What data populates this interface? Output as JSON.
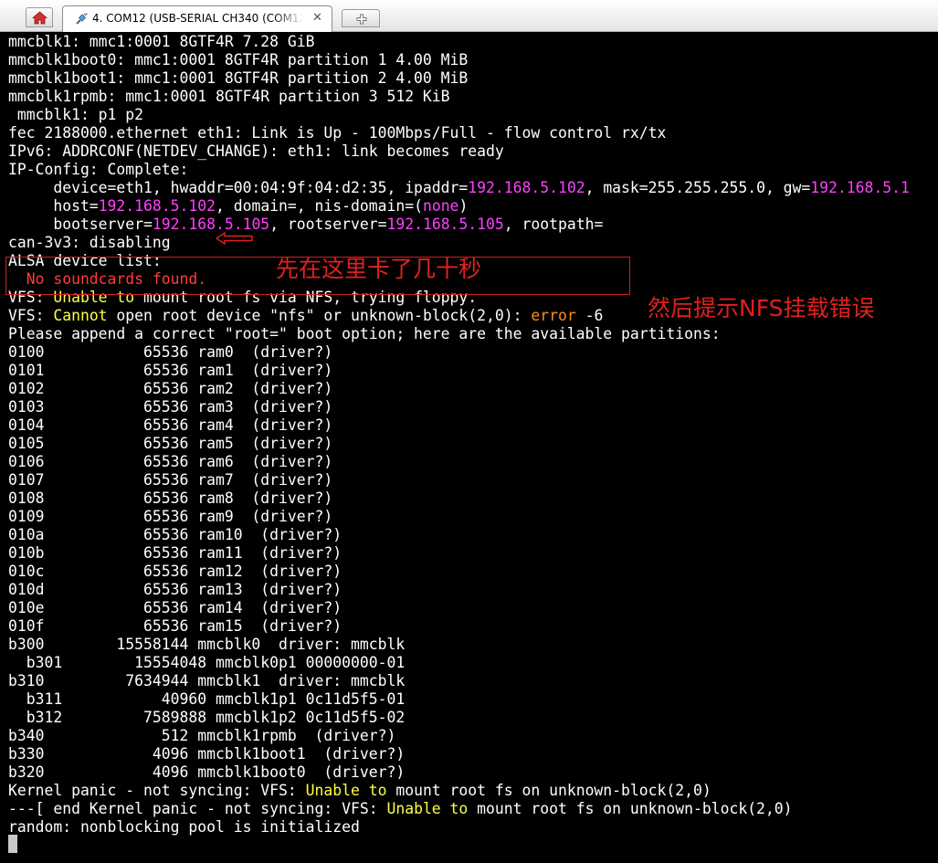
{
  "tab": {
    "title": "4. COM12  (USB-SERIAL CH340 (COM12))",
    "close_glyph": "✕",
    "icon": "plug-icon"
  },
  "icons": {
    "home": "home-icon",
    "new_tab": "new-tab-icon"
  },
  "colors": {
    "background": "#000000",
    "text": "#ffffff",
    "ip_highlight": "#ff40ff",
    "warning_highlight": "#ffff40",
    "error_text": "#ff3c3c",
    "error_code": "#ff8c19",
    "annotation": "#e02020"
  },
  "terminal": {
    "lines": [
      [
        {
          "t": "mmcblk1: mmc1:0001 8GTF4R 7.28 GiB"
        }
      ],
      [
        {
          "t": "mmcblk1boot0: mmc1:0001 8GTF4R partition 1 4.00 MiB"
        }
      ],
      [
        {
          "t": "mmcblk1boot1: mmc1:0001 8GTF4R partition 2 4.00 MiB"
        }
      ],
      [
        {
          "t": "mmcblk1rpmb: mmc1:0001 8GTF4R partition 3 512 KiB"
        }
      ],
      [
        {
          "t": " mmcblk1: p1 p2"
        }
      ],
      [
        {
          "t": "fec 2188000.ethernet eth1: Link is Up - 100Mbps/Full - flow control rx/tx"
        }
      ],
      [
        {
          "t": "IPv6: ADDRCONF(NETDEV_CHANGE): eth1: link becomes ready"
        }
      ],
      [
        {
          "t": "IP-Config: Complete:"
        }
      ],
      [
        {
          "t": "     device=eth1, hwaddr=00:04:9f:04:d2:35, ipaddr="
        },
        {
          "t": "192.168.5.102",
          "c": "mag"
        },
        {
          "t": ", mask=255.255.255.0, gw="
        },
        {
          "t": "192.168.5.1",
          "c": "mag"
        }
      ],
      [
        {
          "t": "     host="
        },
        {
          "t": "192.168.5.102",
          "c": "mag"
        },
        {
          "t": ", domain=, nis-domain=("
        },
        {
          "t": "none",
          "c": "mag"
        },
        {
          "t": ")"
        }
      ],
      [
        {
          "t": "     bootserver="
        },
        {
          "t": "192.168.5.105",
          "c": "mag"
        },
        {
          "t": ", rootserver="
        },
        {
          "t": "192.168.5.105",
          "c": "mag"
        },
        {
          "t": ", rootpath="
        }
      ],
      [
        {
          "t": "can-3v3: disabling"
        }
      ],
      [
        {
          "t": "ALSA device list:"
        }
      ],
      [
        {
          "t": "  No soundcards found.",
          "c": "red"
        }
      ],
      [
        {
          "t": "VFS: "
        },
        {
          "t": "Unable to",
          "c": "yel"
        },
        {
          "t": " mount root fs via NFS, trying floppy."
        }
      ],
      [
        {
          "t": "VFS: "
        },
        {
          "t": "Cannot",
          "c": "yel"
        },
        {
          "t": " open root device \"nfs\" or unknown-block(2,0): "
        },
        {
          "t": "error",
          "c": "org"
        },
        {
          "t": " -6"
        }
      ],
      [
        {
          "t": "Please append a correct \"root=\" boot option; here are the available partitions:"
        }
      ],
      [
        {
          "t": "0100           65536 ram0  (driver?)"
        }
      ],
      [
        {
          "t": "0101           65536 ram1  (driver?)"
        }
      ],
      [
        {
          "t": "0102           65536 ram2  (driver?)"
        }
      ],
      [
        {
          "t": "0103           65536 ram3  (driver?)"
        }
      ],
      [
        {
          "t": "0104           65536 ram4  (driver?)"
        }
      ],
      [
        {
          "t": "0105           65536 ram5  (driver?)"
        }
      ],
      [
        {
          "t": "0106           65536 ram6  (driver?)"
        }
      ],
      [
        {
          "t": "0107           65536 ram7  (driver?)"
        }
      ],
      [
        {
          "t": "0108           65536 ram8  (driver?)"
        }
      ],
      [
        {
          "t": "0109           65536 ram9  (driver?)"
        }
      ],
      [
        {
          "t": "010a           65536 ram10  (driver?)"
        }
      ],
      [
        {
          "t": "010b           65536 ram11  (driver?)"
        }
      ],
      [
        {
          "t": "010c           65536 ram12  (driver?)"
        }
      ],
      [
        {
          "t": "010d           65536 ram13  (driver?)"
        }
      ],
      [
        {
          "t": "010e           65536 ram14  (driver?)"
        }
      ],
      [
        {
          "t": "010f           65536 ram15  (driver?)"
        }
      ],
      [
        {
          "t": "b300        15558144 mmcblk0  driver: mmcblk"
        }
      ],
      [
        {
          "t": "  b301        15554048 mmcblk0p1 00000000-01"
        }
      ],
      [
        {
          "t": "b310         7634944 mmcblk1  driver: mmcblk"
        }
      ],
      [
        {
          "t": "  b311           40960 mmcblk1p1 0c11d5f5-01"
        }
      ],
      [
        {
          "t": "  b312         7589888 mmcblk1p2 0c11d5f5-02"
        }
      ],
      [
        {
          "t": "b340             512 mmcblk1rpmb  (driver?)"
        }
      ],
      [
        {
          "t": "b330            4096 mmcblk1boot1  (driver?)"
        }
      ],
      [
        {
          "t": "b320            4096 mmcblk1boot0  (driver?)"
        }
      ],
      [
        {
          "t": "Kernel panic - not syncing: VFS: "
        },
        {
          "t": "Unable to",
          "c": "yel"
        },
        {
          "t": " mount root fs on unknown-block(2,0)"
        }
      ],
      [
        {
          "t": "---[ end Kernel panic - not syncing: VFS: "
        },
        {
          "t": "Unable to",
          "c": "yel"
        },
        {
          "t": " mount root fs on unknown-block(2,0)"
        }
      ],
      [
        {
          "t": "random: nonblocking pool is initialized"
        }
      ]
    ]
  },
  "annotations": {
    "first": "先在这里卡了几十秒",
    "second": "然后提示NFS挂载错误"
  }
}
